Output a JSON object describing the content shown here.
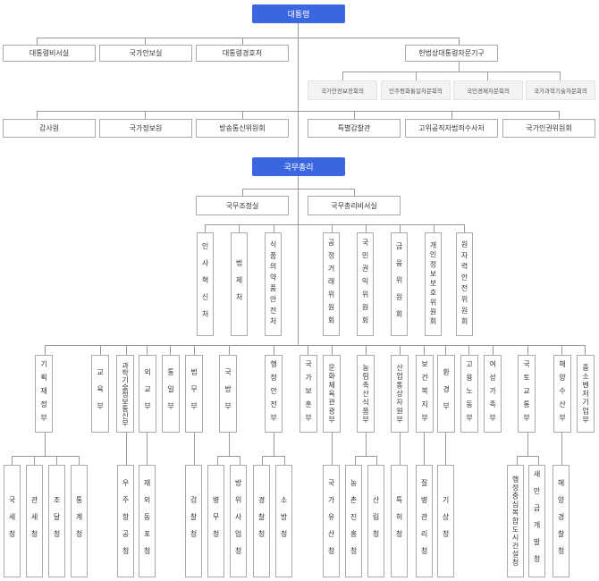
{
  "top": {
    "president": "대통령",
    "president_row": [
      "대통령비서실",
      "국가안보실",
      "대통령경호처"
    ],
    "advisory": "헌법상대통령자문기구",
    "advisory_subs": [
      "국가안전보장회의",
      "민주평화통일자문회의",
      "국민경제자문회의",
      "국가과학기술자문회의"
    ],
    "independent": [
      "감사원",
      "국가정보원",
      "방송통신위원회",
      "특별감찰관",
      "고위공직자범죄수사처",
      "국가인권위원회"
    ],
    "pm": "국무총리",
    "pm_row": [
      "국무조정실",
      "국무총리비서실"
    ]
  },
  "pm_agencies": [
    "인사혁신처",
    "법제처",
    "식품의약품안전처",
    "공정거래위원회",
    "국민권익위원회",
    "금융위원회",
    "개인정보보호위원회",
    "원자력안전위원회"
  ],
  "ministries": [
    "기획재정부",
    "교육부",
    "과학기술정보통신부",
    "외교부",
    "통일부",
    "법무부",
    "국방부",
    "행정안전부",
    "국가보훈부",
    "문화체육관광부",
    "농림축산식품부",
    "산업통상자원부",
    "보건복지부",
    "환경부",
    "고용노동부",
    "여성가족부",
    "국토교통부",
    "해양수산부",
    "중소벤처기업부"
  ],
  "agencies": [
    "국세청",
    "관세청",
    "조달청",
    "통계청",
    "우주항공청",
    "재외동포청",
    "검찰청",
    "병무청",
    "방위사업청",
    "경찰청",
    "소방청",
    "국가유산청",
    "농촌진흥청",
    "산림청",
    "특허청",
    "질병관리청",
    "기상청",
    "행정중심복합도시건설청",
    "새만금개발청",
    "해양경찰청"
  ]
}
